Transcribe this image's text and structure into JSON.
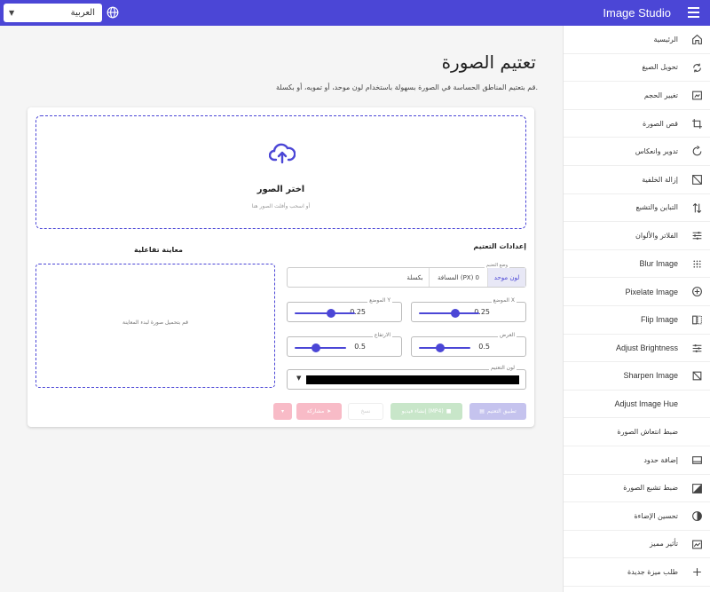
{
  "app": {
    "title": "Image Studio"
  },
  "header": {
    "language": "العربية"
  },
  "sidebar": {
    "items": [
      {
        "label": "الرئيسية",
        "icon": "home-icon",
        "lang": "ar"
      },
      {
        "label": "تحويل الصيغ",
        "icon": "convert-icon",
        "lang": "ar"
      },
      {
        "label": "تغيير الحجم",
        "icon": "resize-icon",
        "lang": "ar"
      },
      {
        "label": "قص الصورة",
        "icon": "crop-icon",
        "lang": "ar"
      },
      {
        "label": "تدوير وانعكاس",
        "icon": "rotate-icon",
        "lang": "ar"
      },
      {
        "label": "إزالة الخلفية",
        "icon": "remove-bg-icon",
        "lang": "ar"
      },
      {
        "label": "التباين والتشبع",
        "icon": "contrast-icon",
        "lang": "ar"
      },
      {
        "label": "الفلاتر والألوان",
        "icon": "filters-icon",
        "lang": "ar"
      },
      {
        "label": "Blur Image",
        "icon": "blur-icon",
        "lang": "en"
      },
      {
        "label": "Pixelate Image",
        "icon": "pixelate-icon",
        "lang": "en"
      },
      {
        "label": "Flip Image",
        "icon": "flip-icon",
        "lang": "en"
      },
      {
        "label": "Adjust Brightness",
        "icon": "brightness-icon",
        "lang": "en"
      },
      {
        "label": "Sharpen Image",
        "icon": "sharpen-icon",
        "lang": "en"
      },
      {
        "label": "Adjust Image Hue",
        "icon": "hue-icon",
        "lang": "en"
      },
      {
        "label": "ضبط انتعاش الصورة",
        "icon": "vibrance-icon",
        "lang": "ar"
      },
      {
        "label": "إضافة حدود",
        "icon": "border-icon",
        "lang": "ar"
      },
      {
        "label": "ضبط تشبع الصورة",
        "icon": "saturation-icon",
        "lang": "ar"
      },
      {
        "label": "تحسين الإضاءة",
        "icon": "exposure-icon",
        "lang": "ar"
      },
      {
        "label": "تأثير مميز",
        "icon": "effect-icon",
        "lang": "ar"
      },
      {
        "label": "طلب ميزة جديدة",
        "icon": "plus-icon",
        "lang": "ar"
      }
    ]
  },
  "main": {
    "title": "تعتيم الصورة",
    "description": "قم بتعتيم المناطق الحساسة في الصورة بسهولة باستخدام لون موحد، أو تمويه، أو بكسلة.",
    "upload": {
      "title": "اختر الصور",
      "subtitle": "أو اسحب وأفلت الصور هنا"
    },
    "settings_label": "إعدادات التعتيم",
    "preview_label": "معاينة تفاعلية",
    "preview_placeholder": "قم بتحميل صورة لبدء المعاينة",
    "mode": {
      "caption": "وضع التعتيم",
      "options": [
        "لون موحد",
        "المسافة (PX) 0",
        "بكسلة"
      ],
      "selected": "لون موحد"
    },
    "fields": {
      "pos_x": {
        "caption": "الموضع X",
        "value": "0.25"
      },
      "pos_y": {
        "caption": "الموضع Y",
        "value": "0.25"
      },
      "width": {
        "caption": "العرض",
        "value": "0.5"
      },
      "height": {
        "caption": "الارتفاع",
        "value": "0.5"
      }
    },
    "color": {
      "caption": "لون التعتيم",
      "value": "#000000"
    },
    "buttons": {
      "apply": "تطبيق التعتيم",
      "video": "إنشاء فيديو (MP4)",
      "copy": "نسخ",
      "share": "مشاركة"
    }
  }
}
